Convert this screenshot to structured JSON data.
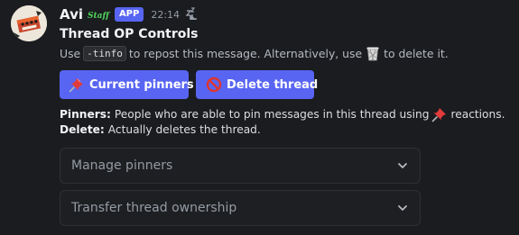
{
  "message": {
    "author": "Avi",
    "staff_tag": "Staff",
    "app_badge": "APP",
    "timestamp": "22:14",
    "snooze_icon": "zzz-icon"
  },
  "embed": {
    "title": "Thread OP Controls",
    "desc_prefix": "Use",
    "desc_code": "-tinfo",
    "desc_middle": "to repost this message. Alternatively, use",
    "desc_suffix": "to delete it."
  },
  "buttons": {
    "current_pinners": "Current pinners",
    "delete_thread": "Delete thread"
  },
  "info": {
    "pinners_label": "Pinners:",
    "pinners_text": "People who are able to pin messages in this thread using",
    "pinners_suffix": "reactions.",
    "delete_label": "Delete:",
    "delete_text": "Actually deletes the thread."
  },
  "selects": {
    "manage_pinners": "Manage pinners",
    "transfer_ownership": "Transfer thread ownership"
  },
  "colors": {
    "background": "#1b1c20",
    "accent": "#5865f2",
    "staff_green": "#4fd45a"
  }
}
